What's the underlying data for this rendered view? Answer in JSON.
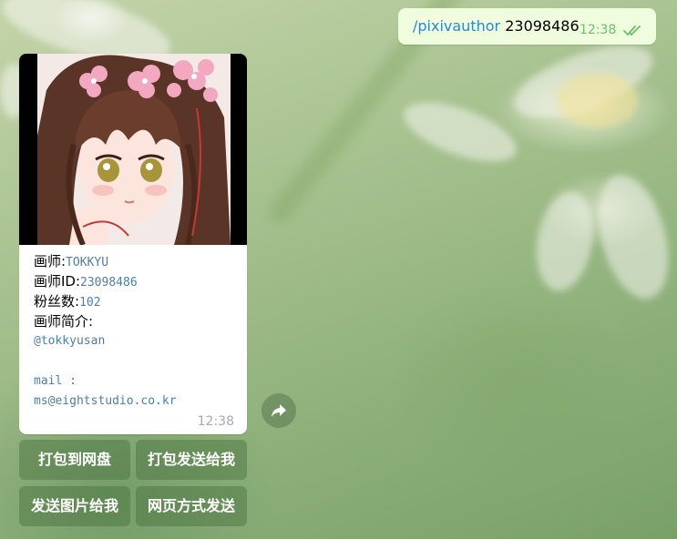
{
  "outgoing": {
    "command": "/pixivauthor",
    "argument": "23098486",
    "time": "12:38"
  },
  "incoming": {
    "lines": [
      {
        "label": "画师:",
        "value": "TOKKYU"
      },
      {
        "label": "画师ID:",
        "value": "23098486"
      },
      {
        "label": "粉丝数:",
        "value": "102"
      },
      {
        "label": "画师简介:",
        "value": ""
      }
    ],
    "bio_lines": [
      "@tokkyusan",
      "",
      "mail :",
      "ms@eightstudio.co.kr"
    ],
    "time": "12:38"
  },
  "keyboard": {
    "buttons": [
      "打包到网盘",
      "打包发送给我",
      "发送图片给我",
      "网页方式发送"
    ]
  },
  "icons": {
    "read_ticks": "double-check-icon",
    "forward": "share-arrow-icon"
  },
  "colors": {
    "outgoing_bubble": "#effdde",
    "command_link": "#2f87c7",
    "outgoing_time": "#6ebd6b",
    "mono_text": "#4e7ea3"
  }
}
